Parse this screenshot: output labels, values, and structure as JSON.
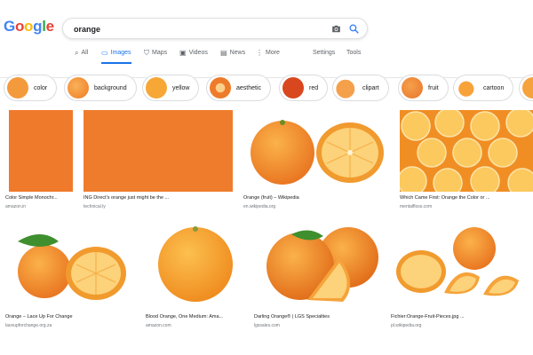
{
  "logo": {
    "letters": [
      "G",
      "o",
      "o",
      "g",
      "l",
      "e"
    ]
  },
  "search": {
    "query": "orange"
  },
  "tabs": [
    {
      "label": "All",
      "icon": "search-icon"
    },
    {
      "label": "Images",
      "icon": "image-icon"
    },
    {
      "label": "Maps",
      "icon": "map-icon"
    },
    {
      "label": "Videos",
      "icon": "video-icon"
    },
    {
      "label": "News",
      "icon": "news-icon"
    },
    {
      "label": "More",
      "icon": "more-icon"
    },
    {
      "label": "Settings"
    },
    {
      "label": "Tools"
    }
  ],
  "chips": [
    {
      "label": "color",
      "color": "#f39a3c"
    },
    {
      "label": "background",
      "color": "#f28a2e"
    },
    {
      "label": "yellow",
      "color": "#f6a735"
    },
    {
      "label": "aesthetic",
      "color": "#ee7b2a"
    },
    {
      "label": "red",
      "color": "#d9471f"
    },
    {
      "label": "clipart",
      "color": "#f08a36"
    },
    {
      "label": "fruit",
      "color": "#ef8833"
    },
    {
      "label": "cartoon",
      "color": "#f59b2f"
    }
  ],
  "results": [
    {
      "caption": "Color Simple Monochr...",
      "source": "amazon.in"
    },
    {
      "caption": "ING Direct's orange just might be the ...",
      "source": "technical.ly"
    },
    {
      "caption": "Orange (fruit) – Wikipedia",
      "source": "en.wikipedia.org"
    },
    {
      "caption": "Which Came First: Orange the Color or ...",
      "source": "mentalfloss.com"
    },
    {
      "caption": "Orange – Lace Up For Change",
      "source": "laceupforchange.org.za"
    },
    {
      "caption": "Blood Orange, One Medium: Ama...",
      "source": "amazon.com"
    },
    {
      "caption": "Darling Orange® | LGS Specialties",
      "source": "lgssales.com"
    },
    {
      "caption": "Fichier:Orange-Fruit-Pieces.jpg ...",
      "source": "pl.wikipedia.org"
    }
  ],
  "colors": {
    "solid_orange": "#f07a2c",
    "swatch_orange": "#ef7c2d",
    "accent_blue": "#1a73e8"
  }
}
